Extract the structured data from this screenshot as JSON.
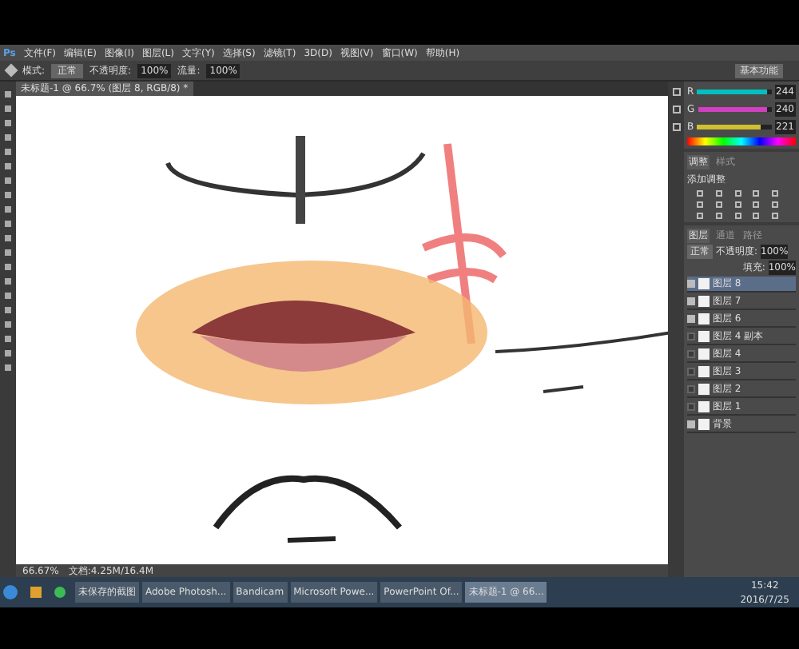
{
  "app": {
    "logo": "Ps"
  },
  "menu": [
    "文件(F)",
    "编辑(E)",
    "图像(I)",
    "图层(L)",
    "文字(Y)",
    "选择(S)",
    "滤镜(T)",
    "3D(D)",
    "视图(V)",
    "窗口(W)",
    "帮助(H)"
  ],
  "options": {
    "mode_label": "模式:",
    "mode": "正常",
    "opacity_label": "不透明度:",
    "opacity": "100%",
    "flow_label": "流量:",
    "flow": "100%"
  },
  "document_tab": {
    "title": "未标题-1 @ 66.7% (图层 8, RGB/8) *"
  },
  "workspace": "基本功能",
  "color_panel": {
    "channels": [
      {
        "name": "R",
        "value": "244",
        "level": 0.95,
        "color": "#00c0c0"
      },
      {
        "name": "G",
        "value": "240",
        "level": 0.94,
        "color": "#d040c0"
      },
      {
        "name": "B",
        "value": "221",
        "level": 0.86,
        "color": "#d0c030"
      }
    ]
  },
  "adjustments_panel": {
    "tabs": [
      {
        "label": "调整",
        "selected": true
      },
      {
        "label": "样式",
        "selected": false
      }
    ],
    "heading": "添加调整"
  },
  "layers_panel": {
    "tabs": [
      {
        "label": "图层",
        "selected": true
      },
      {
        "label": "通道",
        "selected": false
      },
      {
        "label": "路径",
        "selected": false
      }
    ],
    "blend": "正常",
    "opacity_label": "不透明度:",
    "opacity": "100%",
    "fill_label": "填充:",
    "fill": "100%",
    "layers": [
      {
        "name": "图层 8",
        "selected": true,
        "visible": true
      },
      {
        "name": "图层 7",
        "selected": false,
        "visible": true
      },
      {
        "name": "图层 6",
        "selected": false,
        "visible": true
      },
      {
        "name": "图层 4 副本",
        "selected": false,
        "visible": false
      },
      {
        "name": "图层 4",
        "selected": false,
        "visible": false
      },
      {
        "name": "图层 3",
        "selected": false,
        "visible": false
      },
      {
        "name": "图层 2",
        "selected": false,
        "visible": false
      },
      {
        "name": "图层 1",
        "selected": false,
        "visible": false
      },
      {
        "name": "背景",
        "selected": false,
        "visible": true
      }
    ]
  },
  "status_bar": {
    "zoom": "66.67%",
    "doc": "文档:4.25M/16.4M"
  },
  "taskbar": {
    "items": [
      {
        "label": "未保存的截图",
        "selected": false
      },
      {
        "label": "Adobe Photosh...",
        "selected": false
      },
      {
        "label": "Bandicam",
        "selected": false
      },
      {
        "label": "Microsoft Powe...",
        "selected": false
      },
      {
        "label": "PowerPoint Of...",
        "selected": false
      },
      {
        "label": "未标题-1 @ 66...",
        "selected": true
      }
    ],
    "time": "15:42",
    "date": "2016/7/25"
  }
}
